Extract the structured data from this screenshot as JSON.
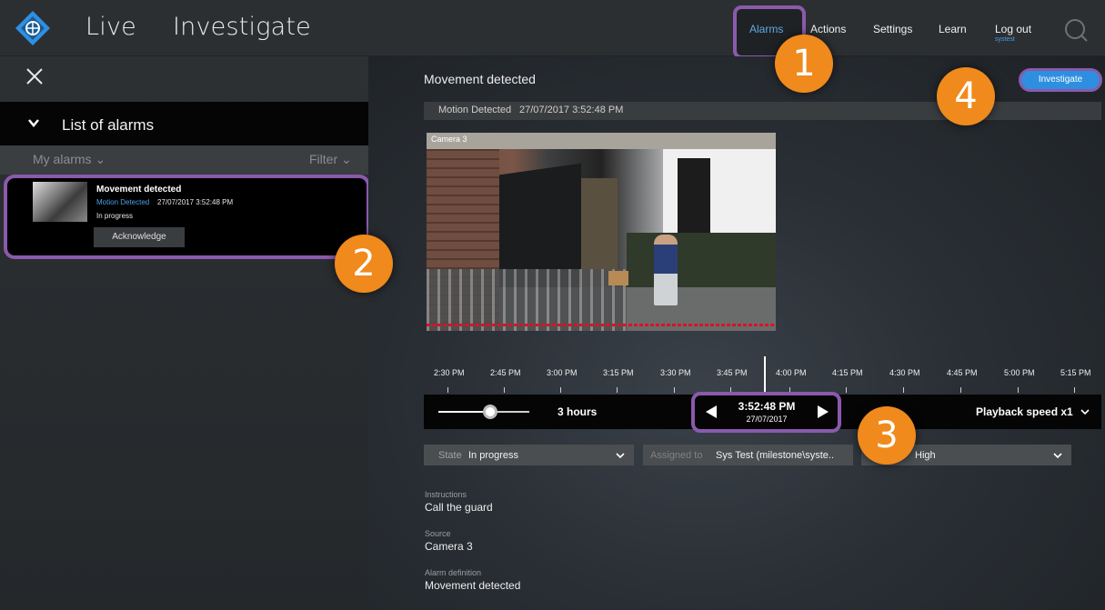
{
  "header": {
    "nav_live": "Live",
    "nav_investigate": "Investigate",
    "links": {
      "alarms": "Alarms",
      "actions": "Actions",
      "settings": "Settings",
      "learn": "Learn",
      "logout": "Log out",
      "user": "systest"
    },
    "icons": {
      "logo": "milestone-logo-icon",
      "search": "search-icon"
    },
    "accent_color": "#4aa0e8"
  },
  "alarm_list": {
    "title": "List of alarms",
    "scope_label": "My alarms ⌄",
    "filter_label": "Filter ⌄",
    "items": [
      {
        "title": "Movement detected",
        "type": "Motion Detected",
        "time": "27/07/2017 3:52:48 PM",
        "status": "In progress",
        "action": "Acknowledge"
      }
    ]
  },
  "detail": {
    "title": "Movement detected",
    "investigate_label": "Investigate",
    "event_type": "Motion Detected",
    "event_time": "27/07/2017 3:52:48 PM",
    "camera_name": "Camera 3"
  },
  "timeline": {
    "labels": [
      "2:30 PM",
      "2:45 PM",
      "3:00 PM",
      "3:15 PM",
      "3:30 PM",
      "3:45 PM",
      "4:00 PM",
      "4:15 PM",
      "4:30 PM",
      "4:45 PM",
      "5:00 PM",
      "5:15 PM"
    ],
    "span_label": "3 hours",
    "current_time": "3:52:48 PM",
    "current_date": "27/07/2017",
    "playback_speed": "Playback speed x1"
  },
  "fields": {
    "state_label": "State",
    "state_value": "In progress",
    "assigned_label": "Assigned to",
    "assigned_value": "Sys Test (milestone\\syste..",
    "priority_value": "High"
  },
  "info": {
    "instructions_label": "Instructions",
    "instructions_value": "Call the guard",
    "source_label": "Source",
    "source_value": "Camera 3",
    "definition_label": "Alarm definition",
    "definition_value": "Movement detected"
  },
  "callouts": [
    "1",
    "2",
    "3",
    "4"
  ],
  "colors": {
    "highlight": "#8a5aac",
    "callout": "#f08a1c",
    "primary_button": "#2e8fe0"
  }
}
